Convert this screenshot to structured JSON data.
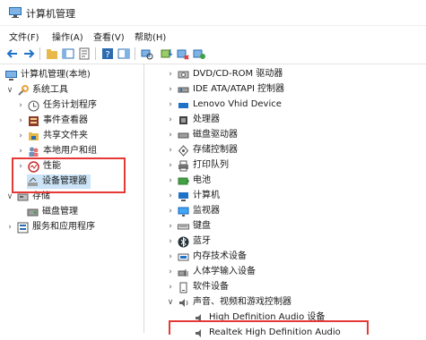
{
  "window": {
    "title": "计算机管理"
  },
  "menu": [
    "文件(F)",
    "操作(A)",
    "查看(V)",
    "帮助(H)"
  ],
  "left_tree": [
    {
      "label": "计算机管理(本地)",
      "level": 0,
      "arrow": "",
      "icon": "computer-management-icon"
    },
    {
      "label": "系统工具",
      "level": 1,
      "arrow": "v",
      "icon": "system-tools-icon"
    },
    {
      "label": "任务计划程序",
      "level": 2,
      "arrow": ">",
      "icon": "clock-icon"
    },
    {
      "label": "事件查看器",
      "level": 2,
      "arrow": ">",
      "icon": "event-viewer-icon"
    },
    {
      "label": "共享文件夹",
      "level": 2,
      "arrow": ">",
      "icon": "shared-folder-icon"
    },
    {
      "label": "本地用户和组",
      "level": 2,
      "arrow": ">",
      "icon": "users-icon"
    },
    {
      "label": "性能",
      "level": 2,
      "arrow": ">",
      "icon": "performance-icon"
    },
    {
      "label": "设备管理器",
      "level": 2,
      "arrow": "",
      "icon": "device-manager-icon",
      "selected": true
    },
    {
      "label": "存储",
      "level": 1,
      "arrow": "v",
      "icon": "storage-icon"
    },
    {
      "label": "磁盘管理",
      "level": 2,
      "arrow": "",
      "icon": "disk-management-icon"
    },
    {
      "label": "服务和应用程序",
      "level": 1,
      "arrow": ">",
      "icon": "services-icon"
    }
  ],
  "right_tree": [
    {
      "label": "DVD/CD-ROM 驱动器",
      "arrow": ">",
      "icon": "dvd-drive-icon"
    },
    {
      "label": "IDE ATA/ATAPI 控制器",
      "arrow": ">",
      "icon": "ide-controller-icon"
    },
    {
      "label": "Lenovo Vhid Device",
      "arrow": ">",
      "icon": "hid-device-icon"
    },
    {
      "label": "处理器",
      "arrow": ">",
      "icon": "processor-icon"
    },
    {
      "label": "磁盘驱动器",
      "arrow": ">",
      "icon": "disk-drive-icon"
    },
    {
      "label": "存储控制器",
      "arrow": ">",
      "icon": "storage-controller-icon"
    },
    {
      "label": "打印队列",
      "arrow": ">",
      "icon": "printer-icon"
    },
    {
      "label": "电池",
      "arrow": ">",
      "icon": "battery-icon"
    },
    {
      "label": "计算机",
      "arrow": ">",
      "icon": "computer-icon"
    },
    {
      "label": "监视器",
      "arrow": ">",
      "icon": "monitor-icon"
    },
    {
      "label": "键盘",
      "arrow": ">",
      "icon": "keyboard-icon"
    },
    {
      "label": "蓝牙",
      "arrow": ">",
      "icon": "bluetooth-icon"
    },
    {
      "label": "内存技术设备",
      "arrow": ">",
      "icon": "memory-device-icon"
    },
    {
      "label": "人体学输入设备",
      "arrow": ">",
      "icon": "hid-input-icon"
    },
    {
      "label": "软件设备",
      "arrow": ">",
      "icon": "software-device-icon"
    },
    {
      "label": "声音、视频和游戏控制器",
      "arrow": "v",
      "icon": "speaker-icon"
    },
    {
      "label": "High Definition Audio 设备",
      "arrow": "",
      "icon": "audio-device-icon",
      "child": true
    },
    {
      "label": "Realtek High Definition Audio",
      "arrow": "",
      "icon": "audio-device-icon",
      "child": true
    }
  ],
  "colors": {
    "highlight": "#e53935",
    "selection": "#cce4f7",
    "accent": "#1e73c8"
  }
}
